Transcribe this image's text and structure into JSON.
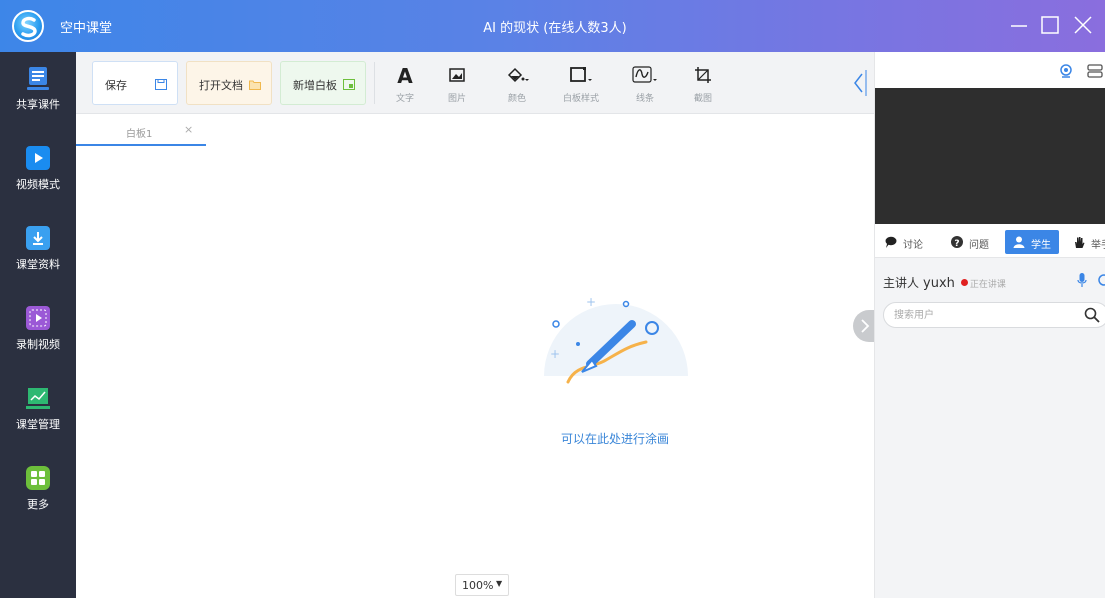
{
  "app": {
    "name": "空中课堂",
    "window_title": "AI 的现状 (在线人数3人)"
  },
  "sidebar": {
    "items": [
      {
        "label": "共享课件",
        "icon": "courseware-icon",
        "color": "#3b86e6"
      },
      {
        "label": "视频模式",
        "icon": "play-icon",
        "color": "#1a8cf0"
      },
      {
        "label": "课堂资料",
        "icon": "download-file-icon",
        "color": "#3aa0f0"
      },
      {
        "label": "录制视频",
        "icon": "record-video-icon",
        "color": "#9b59d6"
      },
      {
        "label": "课堂管理",
        "icon": "chart-board-icon",
        "color": "#2eb872"
      },
      {
        "label": "更多",
        "icon": "grid-icon",
        "color": "#6dbf3b"
      }
    ]
  },
  "toolbar": {
    "save_label": "保存",
    "open_doc_label": "打开文档",
    "new_board_label": "新增白板",
    "tools": [
      {
        "label": "文字",
        "icon": "text-icon"
      },
      {
        "label": "图片",
        "icon": "image-icon"
      },
      {
        "label": "颜色",
        "icon": "paint-bucket-icon"
      },
      {
        "label": "白板样式",
        "icon": "board-style-icon"
      },
      {
        "label": "线条",
        "icon": "line-icon"
      },
      {
        "label": "截图",
        "icon": "crop-icon"
      }
    ]
  },
  "tabs": [
    {
      "label": "白板1",
      "close": "×"
    }
  ],
  "canvas": {
    "hint": "可以在此处进行涂画",
    "zoom": "100%",
    "zoom_arrow": "▼"
  },
  "right_panel": {
    "tabs": [
      {
        "label": "讨论",
        "icon": "chat-icon"
      },
      {
        "label": "问题",
        "icon": "question-icon"
      },
      {
        "label": "学生",
        "icon": "user-icon",
        "active": true
      },
      {
        "label": "举手",
        "icon": "hand-icon"
      }
    ],
    "presenter_label": "主讲人",
    "presenter_name": "yuxh",
    "presenter_status": "正在讲课",
    "search_placeholder": "搜索用户"
  },
  "colors": {
    "accent": "#3b86e6",
    "sidebar_bg": "#2b3040",
    "status_live": "#e02020"
  }
}
